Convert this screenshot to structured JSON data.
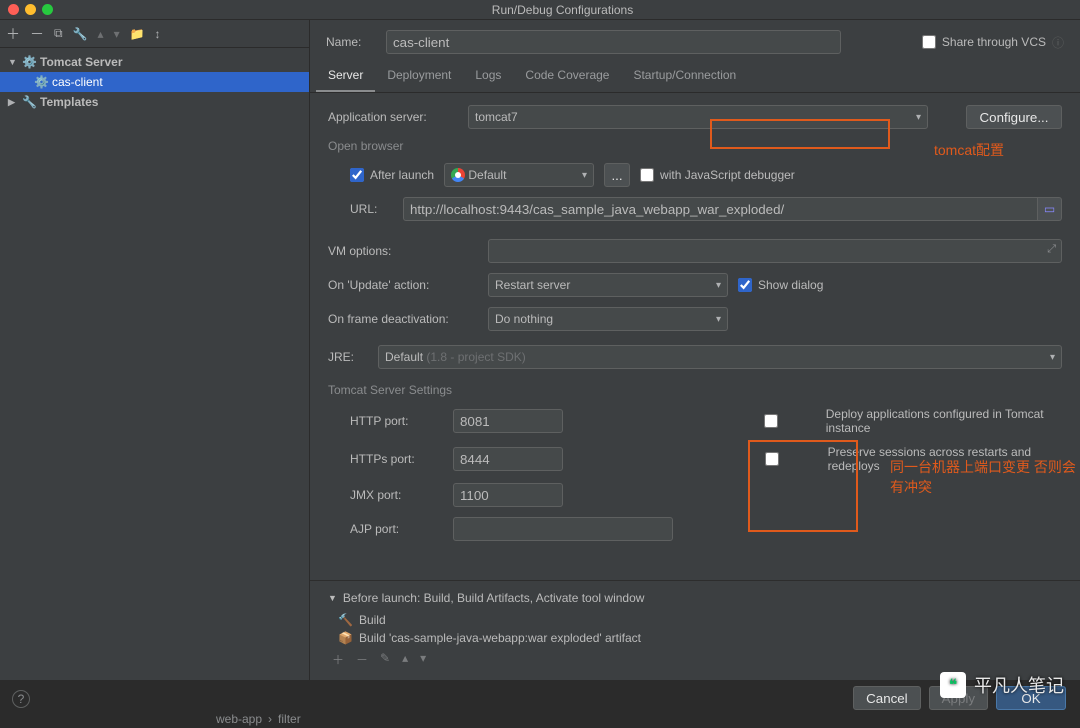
{
  "window": {
    "title": "Run/Debug Configurations"
  },
  "share": {
    "label": "Share through VCS"
  },
  "name": {
    "label": "Name:",
    "value": "cas-client"
  },
  "tree": {
    "root": "Tomcat Server",
    "item": "cas-client",
    "templates": "Templates"
  },
  "tabs": {
    "server": "Server",
    "deployment": "Deployment",
    "logs": "Logs",
    "coverage": "Code Coverage",
    "startup": "Startup/Connection"
  },
  "appserver": {
    "label": "Application server:",
    "value": "tomcat7",
    "configure": "Configure..."
  },
  "annotations": {
    "tomcat": "tomcat配置",
    "ports": "同一台机器上端口变更 否则会有冲突"
  },
  "open_browser": {
    "title": "Open browser",
    "after_launch": "After launch",
    "browser": "Default",
    "dots": "...",
    "js_dbg": "with JavaScript debugger",
    "url_label": "URL:",
    "url": "http://localhost:9443/cas_sample_java_webapp_war_exploded/"
  },
  "vm": {
    "label": "VM options:"
  },
  "update": {
    "label": "On 'Update' action:",
    "value": "Restart server",
    "show_dialog": "Show dialog"
  },
  "frame": {
    "label": "On frame deactivation:",
    "value": "Do nothing"
  },
  "jre": {
    "label": "JRE:",
    "value": "Default",
    "hint": "(1.8 - project SDK)"
  },
  "tomcat_settings": {
    "title": "Tomcat Server Settings",
    "http": "HTTP port:",
    "http_v": "8081",
    "https": "HTTPs port:",
    "https_v": "8444",
    "jmx": "JMX port:",
    "jmx_v": "1100",
    "ajp": "AJP port:",
    "ajp_v": "",
    "deploy_cb": "Deploy applications configured in Tomcat instance",
    "preserve_cb": "Preserve sessions across restarts and redeploys"
  },
  "before_launch": {
    "title": "Before launch: Build, Build Artifacts, Activate tool window",
    "b1": "Build",
    "b2": "Build 'cas-sample-java-webapp:war exploded' artifact"
  },
  "buttons": {
    "cancel": "Cancel",
    "apply": "Apply",
    "ok": "OK"
  },
  "breadcrumb": {
    "a": "web-app",
    "b": "filter"
  },
  "watermark": "平凡人笔记"
}
